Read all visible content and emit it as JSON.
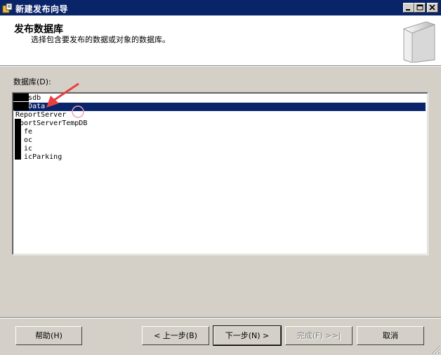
{
  "window": {
    "title": "新建发布向导"
  },
  "header": {
    "title": "发布数据库",
    "subtitle": "选择包含要发布的数据或对象的数据库。"
  },
  "database_list": {
    "label": "数据库(D):",
    "items": [
      {
        "text": "   sdb",
        "selected": false
      },
      {
        "text": "   Data",
        "selected": true
      },
      {
        "text": "ReportServer",
        "selected": false
      },
      {
        "text": " portServerTempDB",
        "selected": false
      },
      {
        "text": "  fe",
        "selected": false
      },
      {
        "text": "  oc",
        "selected": false
      },
      {
        "text": "  ic",
        "selected": false
      },
      {
        "text": "  icParking",
        "selected": false
      }
    ]
  },
  "buttons": {
    "help": "帮助(H)",
    "back": "< 上一步(B)",
    "next": "下一步(N) >",
    "finish": "完成(F) >>|",
    "cancel": "取消"
  },
  "colors": {
    "titlebar": "#0a246a",
    "selection": "#0a246a",
    "annotation_arrow": "#e84040",
    "face": "#d4d0c8"
  },
  "icons": {
    "app": "wizard-app-icon",
    "header_graphic": "book-icon",
    "annotation": "red-arrow-annotation"
  }
}
